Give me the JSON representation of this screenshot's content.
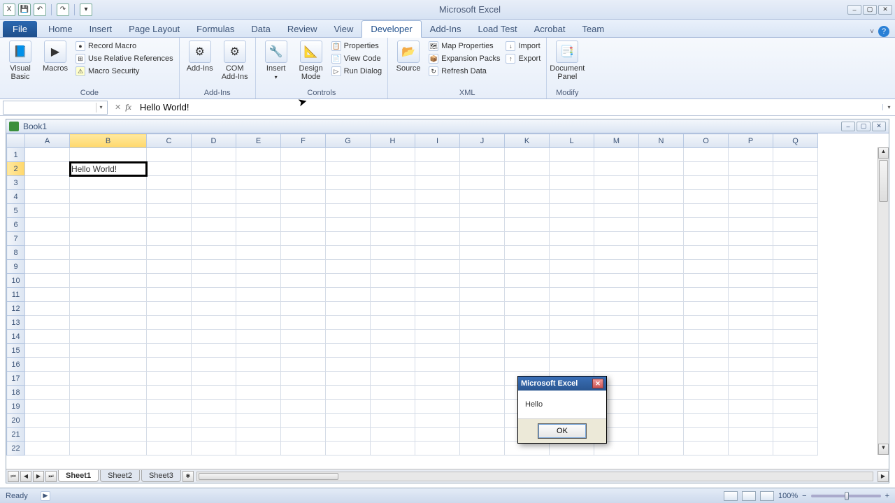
{
  "app": {
    "title": "Microsoft Excel"
  },
  "qat": {
    "save": "💾",
    "undo": "↶",
    "redo": "↷"
  },
  "tabs": {
    "file": "File",
    "home": "Home",
    "insert": "Insert",
    "pagelayout": "Page Layout",
    "formulas": "Formulas",
    "data": "Data",
    "review": "Review",
    "view": "View",
    "developer": "Developer",
    "addins": "Add-Ins",
    "loadtest": "Load Test",
    "acrobat": "Acrobat",
    "team": "Team"
  },
  "ribbon": {
    "code": {
      "vb": "Visual\nBasic",
      "macros": "Macros",
      "record": "Record Macro",
      "userel": "Use Relative References",
      "msec": "Macro Security",
      "label": "Code"
    },
    "addins": {
      "addins": "Add-Ins",
      "com": "COM\nAdd-Ins",
      "label": "Add-Ins"
    },
    "controls": {
      "insert": "Insert",
      "design": "Design\nMode",
      "props": "Properties",
      "viewcode": "View Code",
      "rundlg": "Run Dialog",
      "label": "Controls"
    },
    "xml": {
      "source": "Source",
      "mapprops": "Map Properties",
      "exp": "Expansion Packs",
      "refresh": "Refresh Data",
      "import": "Import",
      "export": "Export",
      "label": "XML"
    },
    "modify": {
      "docpanel": "Document\nPanel",
      "label": "Modify"
    }
  },
  "formula_bar": {
    "fx": "fx",
    "value": "Hello World!"
  },
  "workbook": {
    "title": "Book1",
    "cols": [
      "A",
      "B",
      "C",
      "D",
      "E",
      "F",
      "G",
      "H",
      "I",
      "J",
      "K",
      "L",
      "M",
      "N",
      "O",
      "P",
      "Q"
    ],
    "rows": [
      "1",
      "2",
      "3",
      "4",
      "5",
      "6",
      "7",
      "8",
      "9",
      "10",
      "11",
      "12",
      "13",
      "14",
      "15",
      "16",
      "17",
      "18",
      "19",
      "20",
      "21",
      "22"
    ],
    "selected_col": "B",
    "selected_row": "2",
    "cell_b2": "Hello World!",
    "sheets": [
      "Sheet1",
      "Sheet2",
      "Sheet3"
    ]
  },
  "status": {
    "ready": "Ready",
    "zoom": "100%"
  },
  "msgbox": {
    "title": "Microsoft Excel",
    "body": "Hello",
    "ok": "OK"
  }
}
